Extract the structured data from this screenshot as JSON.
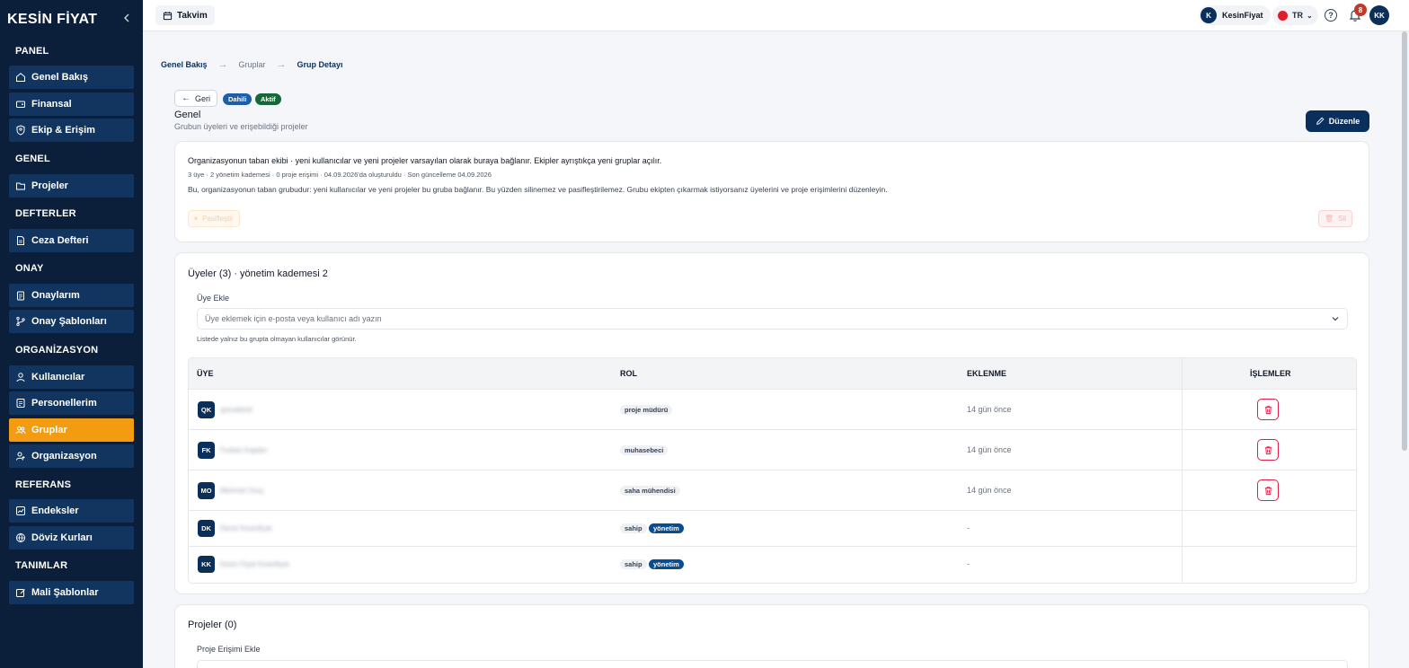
{
  "sidebar": {
    "logo": "KESİN FİYAT",
    "collapse_icon": "chevron-left",
    "sections": [
      {
        "title": "PANEL",
        "items": [
          {
            "label": "Genel Bakış",
            "icon": "home-icon"
          },
          {
            "label": "Finansal",
            "icon": "wallet-icon"
          },
          {
            "label": "Ekip & Erişim",
            "icon": "shield-user-icon"
          }
        ]
      },
      {
        "title": "GENEL",
        "items": [
          {
            "label": "Projeler",
            "icon": "folder-icon"
          }
        ]
      },
      {
        "title": "DEFTERLER",
        "items": [
          {
            "label": "Ceza Defteri",
            "icon": "document-icon"
          }
        ]
      },
      {
        "title": "ONAY",
        "items": [
          {
            "label": "Onaylarım",
            "icon": "clipboard-icon"
          },
          {
            "label": "Onay Şablonları",
            "icon": "branch-icon"
          }
        ]
      },
      {
        "title": "ORGANİZASYON",
        "items": [
          {
            "label": "Kullanıcılar",
            "icon": "user-icon"
          },
          {
            "label": "Personellerim",
            "icon": "id-card-icon"
          },
          {
            "label": "Gruplar",
            "icon": "users-icon",
            "active": true
          },
          {
            "label": "Organizasyon",
            "icon": "org-icon"
          }
        ]
      },
      {
        "title": "REFERANS",
        "items": [
          {
            "label": "Endeksler",
            "icon": "chart-icon"
          },
          {
            "label": "Döviz Kurları",
            "icon": "globe-icon"
          }
        ]
      },
      {
        "title": "TANIMLAR",
        "items": [
          {
            "label": "Mali Şablonlar",
            "icon": "edit-icon"
          }
        ]
      }
    ]
  },
  "topbar": {
    "calendar_label": "Takvim",
    "org_initial": "K",
    "org_name": "KesinFiyat",
    "lang": "TR",
    "notifications_count": "8",
    "user_initials": "KK"
  },
  "breadcrumb": [
    "Genel Bakış",
    "Gruplar",
    "Grup Detayı"
  ],
  "header": {
    "back_label": "Geri",
    "badge_internal": "Dahili",
    "badge_active": "Aktif",
    "title": "Genel",
    "subtitle": "Grubun üyeleri ve erişebildiği projeler",
    "edit_label": "Düzenle"
  },
  "info_card": {
    "description": "Organizasyonun taban ekibi · yeni kullanıcılar ve yeni projeler varsayılan olarak buraya bağlanır. Ekipler ayrıştıkça yeni gruplar açılır.",
    "meta": "3 üye · 2 yönetim kademesi · 0 proje erişimi · 04.09.2026'da oluşturuldu · Son güncelleme 04.09.2026",
    "note": "Bu, organizasyonun taban grubudur: yeni kullanıcılar ve yeni projeler bu gruba bağlanır. Bu yüzden silinemez ve pasifleştirilemez. Grubu ekipten çıkarmak istiyorsanız üyelerini ve proje erişimlerini düzenleyin.",
    "deactivate_label": "Pasifleştir",
    "delete_label": "Sil"
  },
  "members": {
    "title": "Üyeler (3) · yönetim kademesi 2",
    "add_label": "Üye Ekle",
    "add_placeholder": "Üye eklemek için e-posta veya kullanıcı adı yazın",
    "hint": "Listede yalnız bu grupta olmayan kullanıcılar görünür.",
    "columns": [
      "ÜYE",
      "ROL",
      "EKLENME",
      "İŞLEMLER"
    ],
    "rows": [
      {
        "initials": "QK",
        "name": "qmcekimli",
        "roles": [
          "proje müdürü"
        ],
        "added": "14 gün önce",
        "deletable": true
      },
      {
        "initials": "FK",
        "name": "Furkan Kaplan",
        "roles": [
          "muhasebeci"
        ],
        "added": "14 gün önce",
        "deletable": true
      },
      {
        "initials": "MO",
        "name": "Mehmet Oruç",
        "roles": [
          "saha mühendisi"
        ],
        "added": "14 gün önce",
        "deletable": true
      },
      {
        "initials": "DK",
        "name": "Deniz Kesinfiyat",
        "roles": [
          "sahip",
          "yönetim"
        ],
        "added": "-",
        "deletable": false
      },
      {
        "initials": "KK",
        "name": "Kesin Fiyat Kesinfiyat",
        "roles": [
          "sahip",
          "yönetim"
        ],
        "added": "-",
        "deletable": false
      }
    ]
  },
  "projects": {
    "title": "Projeler (0)",
    "add_label": "Proje Erişimi Ekle"
  }
}
